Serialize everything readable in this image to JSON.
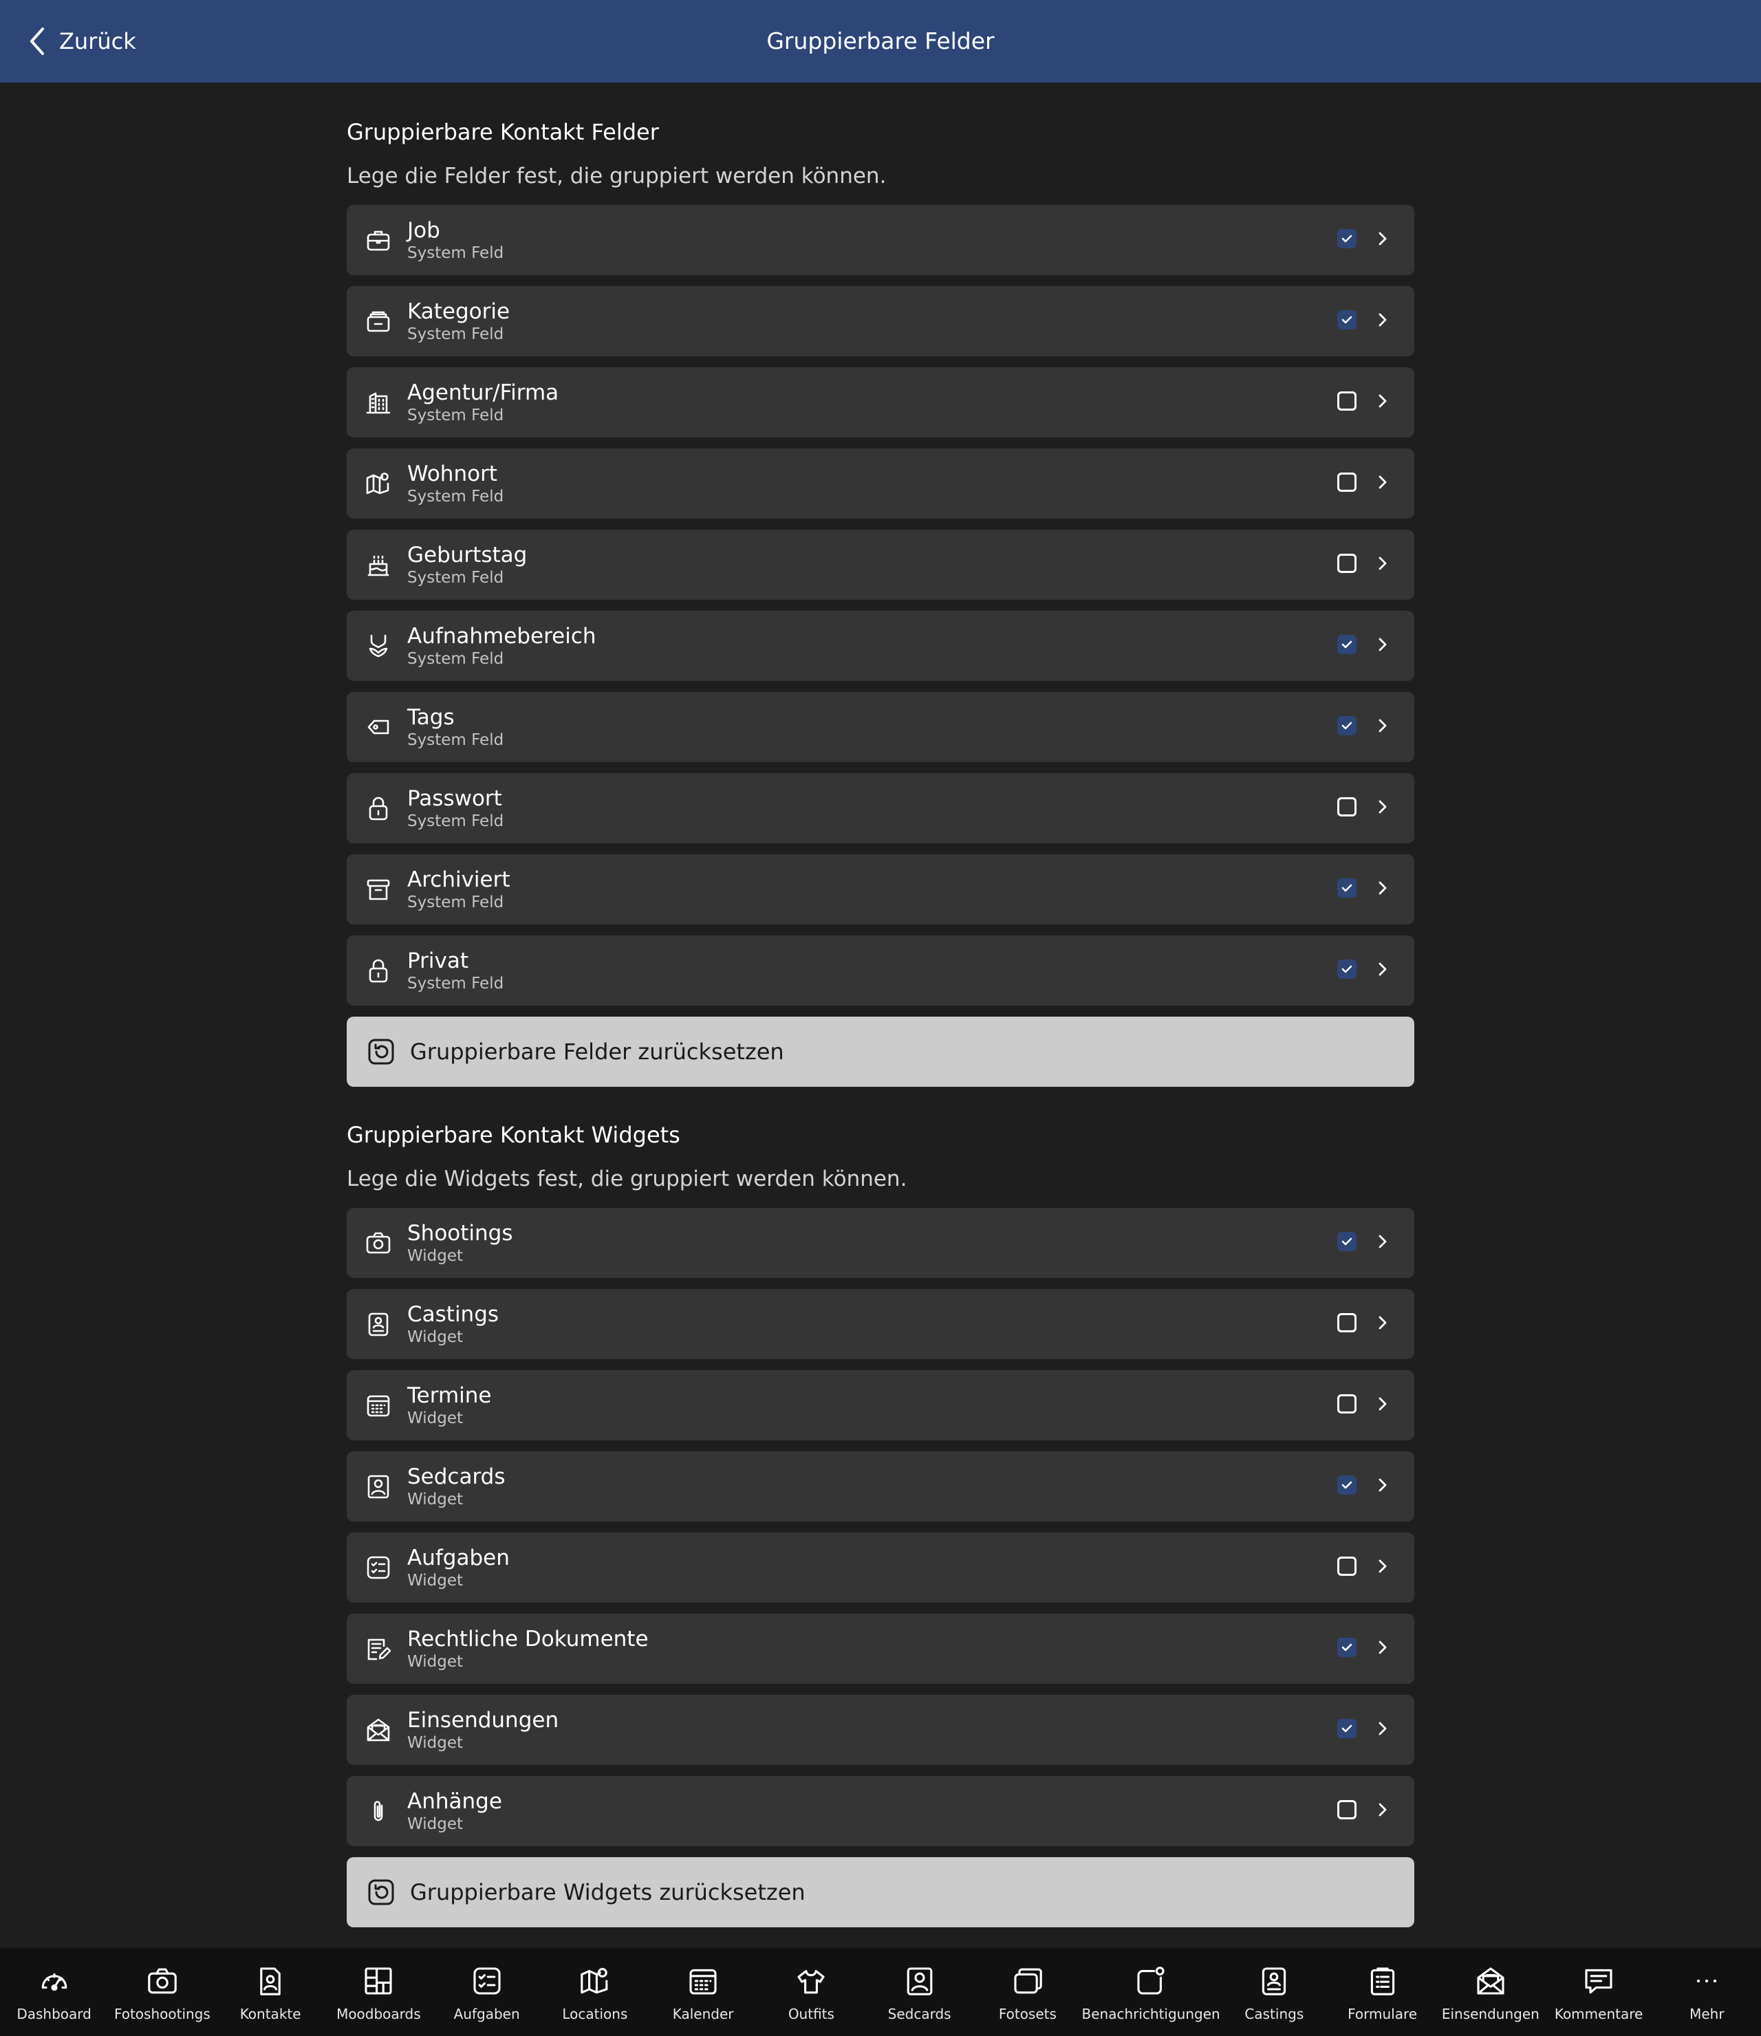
{
  "header": {
    "back_label": "Zurück",
    "title": "Gruppierbare Felder"
  },
  "fields_section": {
    "title": "Gruppierbare Kontakt Felder",
    "description": "Lege die Felder fest, die gruppiert werden können.",
    "items": [
      {
        "label": "Job",
        "sub": "System Feld",
        "checked": true,
        "icon": "briefcase-icon"
      },
      {
        "label": "Kategorie",
        "sub": "System Feld",
        "checked": true,
        "icon": "category-icon"
      },
      {
        "label": "Agentur/Firma",
        "sub": "System Feld",
        "checked": false,
        "icon": "building-icon"
      },
      {
        "label": "Wohnort",
        "sub": "System Feld",
        "checked": false,
        "icon": "map-pin-icon"
      },
      {
        "label": "Geburtstag",
        "sub": "System Feld",
        "checked": false,
        "icon": "cake-icon"
      },
      {
        "label": "Aufnahmebereich",
        "sub": "System Feld",
        "checked": true,
        "icon": "bikini-icon"
      },
      {
        "label": "Tags",
        "sub": "System Feld",
        "checked": true,
        "icon": "tag-icon"
      },
      {
        "label": "Passwort",
        "sub": "System Feld",
        "checked": false,
        "icon": "lock-icon"
      },
      {
        "label": "Archiviert",
        "sub": "System Feld",
        "checked": true,
        "icon": "archive-icon"
      },
      {
        "label": "Privat",
        "sub": "System Feld",
        "checked": true,
        "icon": "lock-icon"
      }
    ],
    "reset_label": "Gruppierbare Felder zurücksetzen"
  },
  "widgets_section": {
    "title": "Gruppierbare Kontakt Widgets",
    "description": "Lege die Widgets fest, die gruppiert werden können.",
    "items": [
      {
        "label": "Shootings",
        "sub": "Widget",
        "checked": true,
        "icon": "camera-icon"
      },
      {
        "label": "Castings",
        "sub": "Widget",
        "checked": false,
        "icon": "id-card-icon"
      },
      {
        "label": "Termine",
        "sub": "Widget",
        "checked": false,
        "icon": "calendar-icon"
      },
      {
        "label": "Sedcards",
        "sub": "Widget",
        "checked": true,
        "icon": "portrait-icon"
      },
      {
        "label": "Aufgaben",
        "sub": "Widget",
        "checked": false,
        "icon": "checklist-icon"
      },
      {
        "label": "Rechtliche Dokumente",
        "sub": "Widget",
        "checked": true,
        "icon": "document-edit-icon"
      },
      {
        "label": "Einsendungen",
        "sub": "Widget",
        "checked": true,
        "icon": "envelope-open-icon"
      },
      {
        "label": "Anhänge",
        "sub": "Widget",
        "checked": false,
        "icon": "paperclip-icon"
      }
    ],
    "reset_label": "Gruppierbare Widgets zurücksetzen"
  },
  "tabbar": [
    {
      "label": "Dashboard",
      "icon": "gauge-icon"
    },
    {
      "label": "Fotoshootings",
      "icon": "camera-icon"
    },
    {
      "label": "Kontakte",
      "icon": "contact-icon"
    },
    {
      "label": "Moodboards",
      "icon": "moodboard-icon"
    },
    {
      "label": "Aufgaben",
      "icon": "checklist-icon"
    },
    {
      "label": "Locations",
      "icon": "map-pin-icon"
    },
    {
      "label": "Kalender",
      "icon": "calendar-icon"
    },
    {
      "label": "Outfits",
      "icon": "shirt-icon"
    },
    {
      "label": "Sedcards",
      "icon": "portrait-icon"
    },
    {
      "label": "Fotosets",
      "icon": "photo-stack-icon"
    },
    {
      "label": "Benachrichtigungen",
      "icon": "notification-icon"
    },
    {
      "label": "Castings",
      "icon": "id-card-icon"
    },
    {
      "label": "Formulare",
      "icon": "clipboard-icon"
    },
    {
      "label": "Einsendungen",
      "icon": "envelope-open-icon"
    },
    {
      "label": "Kommentare",
      "icon": "comment-icon"
    },
    {
      "label": "Mehr",
      "icon": "more-icon"
    }
  ],
  "colors": {
    "header": "#2d4677",
    "background": "#1e1e1e",
    "row": "#353535",
    "checkbox_checked": "#2d4677",
    "reset_button": "#cccccc"
  }
}
